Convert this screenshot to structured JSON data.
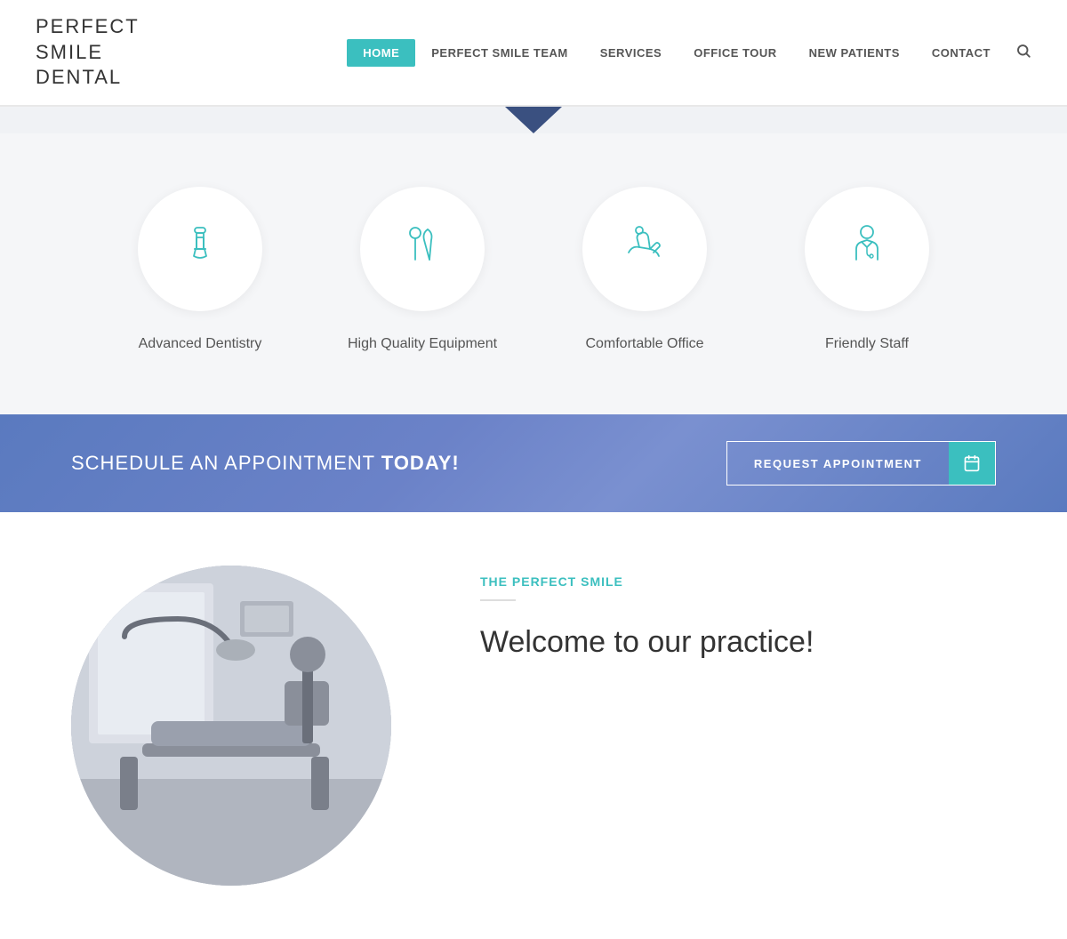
{
  "header": {
    "logo": "PERFECT SMILE DENTAL",
    "logo_lines": [
      "PERFECT",
      "SMILE",
      "DENTAL"
    ]
  },
  "nav": {
    "items": [
      {
        "label": "HOME",
        "active": true
      },
      {
        "label": "PERFECT SMILE TEAM",
        "active": false
      },
      {
        "label": "SERVICES",
        "active": false
      },
      {
        "label": "OFFICE TOUR",
        "active": false
      },
      {
        "label": "NEW PATIENTS",
        "active": false
      },
      {
        "label": "CONTACT",
        "active": false
      }
    ]
  },
  "features": {
    "items": [
      {
        "label": "Advanced Dentistry",
        "icon": "implant"
      },
      {
        "label": "High Quality Equipment",
        "icon": "tools"
      },
      {
        "label": "Comfortable Office",
        "icon": "comfort"
      },
      {
        "label": "Friendly Staff",
        "icon": "staff"
      }
    ]
  },
  "appointment": {
    "text_regular": "SCHEDULE AN APPOINTMENT ",
    "text_bold": "TODAY!",
    "button_label": "REQUEST APPOINTMENT"
  },
  "welcome": {
    "subtitle": "THE PERFECT SMILE",
    "title": "Welcome to our practice!"
  },
  "colors": {
    "teal": "#3bbfbf",
    "navy": "#3a5080",
    "purple_banner": "#6b82c8",
    "text_dark": "#333333",
    "text_mid": "#555555",
    "bg_light": "#f5f6f8"
  }
}
